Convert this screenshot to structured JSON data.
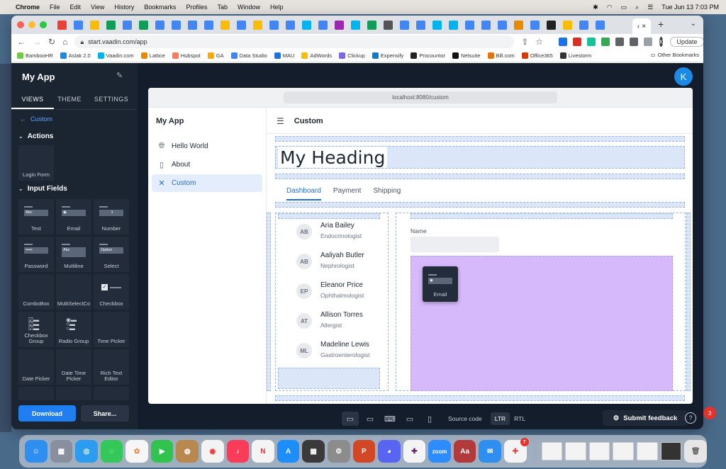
{
  "menubar": {
    "app": "Chrome",
    "items": [
      "File",
      "Edit",
      "View",
      "History",
      "Bookmarks",
      "Profiles",
      "Tab",
      "Window",
      "Help"
    ],
    "clock": "Tue Jun 13  7:03 PM"
  },
  "browser": {
    "url": "start.vaadin.com/app",
    "update_label": "Update",
    "profile_initial": "K",
    "bookmarks": [
      "BambooHR",
      "Aslak 2.0",
      "Vaadin.com",
      "Lattice",
      "Hubspot",
      "GA",
      "Data Studio",
      "MAU",
      "AdWords",
      "Clickup",
      "Expensify",
      "Procountor",
      "Netsuite",
      "Bill.com",
      "Office365",
      "Livestorm"
    ],
    "other_bookmarks": "Other Bookmarks"
  },
  "sidebar": {
    "app_title": "My App",
    "tabs": [
      "VIEWS",
      "THEME",
      "SETTINGS"
    ],
    "breadcrumb": "Custom",
    "sections": {
      "actions": "Actions",
      "inputs": "Input Fields"
    },
    "action_tiles": [
      "Login Form"
    ],
    "field_tiles": [
      "Text",
      "Email",
      "Number",
      "Password",
      "Multiline",
      "Select",
      "ComboBox",
      "MultiSelectCo",
      "Checkbox",
      "Checkbox Group",
      "Radio Group",
      "Time Picker",
      "Date Picker",
      "Date Time Picker",
      "Rich Text Editor"
    ],
    "tile_previews": {
      "text": "Abc",
      "number": "1",
      "password": "•••••",
      "multiline": "Abc",
      "select": "Option"
    },
    "download_label": "Download",
    "share_label": "Share..."
  },
  "user_initial": "K",
  "preview": {
    "url": "localhost:8080/custom",
    "app_name": "My App",
    "nav": [
      {
        "label": "Hello World",
        "icon": "globe-icon"
      },
      {
        "label": "About",
        "icon": "file-icon"
      },
      {
        "label": "Custom",
        "icon": "tools-icon"
      }
    ],
    "header_title": "Custom",
    "heading": "My Heading",
    "tabs": [
      "Dashboard",
      "Payment",
      "Shipping"
    ],
    "people": [
      {
        "initials": "AB",
        "name": "Aria Bailey",
        "role": "Endocrinologist"
      },
      {
        "initials": "AB",
        "name": "Aaliyah Butler",
        "role": "Nephrologist"
      },
      {
        "initials": "EP",
        "name": "Eleanor Price",
        "role": "Ophthalmologist"
      },
      {
        "initials": "AT",
        "name": "Allison Torres",
        "role": "Allergist"
      },
      {
        "initials": "ML",
        "name": "Madeline Lewis",
        "role": "Gastroenterologist"
      }
    ],
    "name_label": "Name",
    "drag_label": "Email"
  },
  "bottombar": {
    "source_code": "Source code",
    "ltr": "LTR",
    "rtl": "RTL",
    "feedback": "Submit feedback",
    "help": "?"
  },
  "dock": {
    "zoom_label": "zoom",
    "dictionary_label": "Aa",
    "badge_slack": "7",
    "badge_notif": "3"
  },
  "colors": {
    "accent": "#1f7ff0",
    "sidebar_bg": "#1b2431",
    "drop_zone": "#d6b9fb",
    "selection": "#dbe6f8"
  }
}
